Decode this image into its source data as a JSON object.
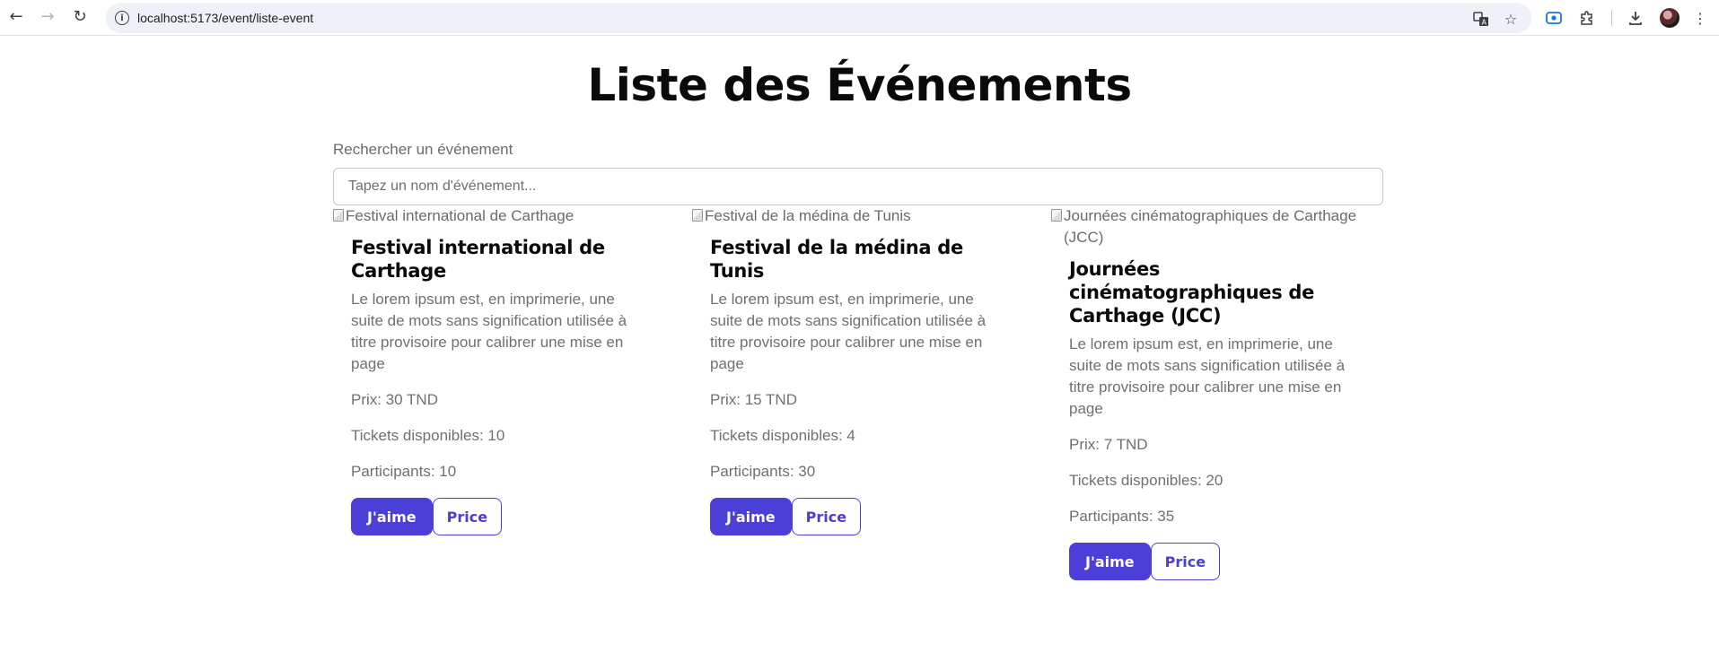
{
  "browser": {
    "url": "localhost:5173/event/liste-event",
    "icons": {
      "back": "arrow-left-icon",
      "forward": "arrow-right-icon",
      "reload": "reload-icon",
      "site_info": "info-icon",
      "translate": "translate-icon",
      "bookmark": "star-icon",
      "extension_active": "screen-capture-icon",
      "extensions": "puzzle-icon",
      "downloads": "download-icon",
      "profile": "avatar",
      "menu": "kebab-menu-icon"
    }
  },
  "page": {
    "title": "Liste des Événements",
    "search": {
      "label": "Rechercher un événement",
      "placeholder": "Tapez un nom d'événement...",
      "value": ""
    }
  },
  "events": [
    {
      "image_alt": "Festival international de Carthage",
      "title": "Festival international de Carthage",
      "description": "Le lorem ipsum est, en imprimerie, une suite de mots sans signification utilisée à titre provisoire pour calibrer une mise en page",
      "price": "Prix: 30 TND",
      "tickets": "Tickets disponibles: 10",
      "participants": "Participants: 10",
      "like_label": "J'aime",
      "price_label": "Price"
    },
    {
      "image_alt": "Festival de la médina de Tunis",
      "title": "Festival de la médina de Tunis",
      "description": "Le lorem ipsum est, en imprimerie, une suite de mots sans signification utilisée à titre provisoire pour calibrer une mise en page",
      "price": "Prix: 15 TND",
      "tickets": "Tickets disponibles: 4",
      "participants": "Participants: 30",
      "like_label": "J'aime",
      "price_label": "Price"
    },
    {
      "image_alt": "Journées cinématographiques de Carthage (JCC)",
      "title": "Journées cinématographiques de Carthage (JCC)",
      "description": "Le lorem ipsum est, en imprimerie, une suite de mots sans signification utilisée à titre provisoire pour calibrer une mise en page",
      "price": "Prix: 7 TND",
      "tickets": "Tickets disponibles: 20",
      "participants": "Participants: 35",
      "like_label": "J'aime",
      "price_label": "Price"
    }
  ],
  "colors": {
    "accent": "#4b3fd8",
    "muted_text": "#707070",
    "omnibox_bg": "#eef1f8"
  }
}
